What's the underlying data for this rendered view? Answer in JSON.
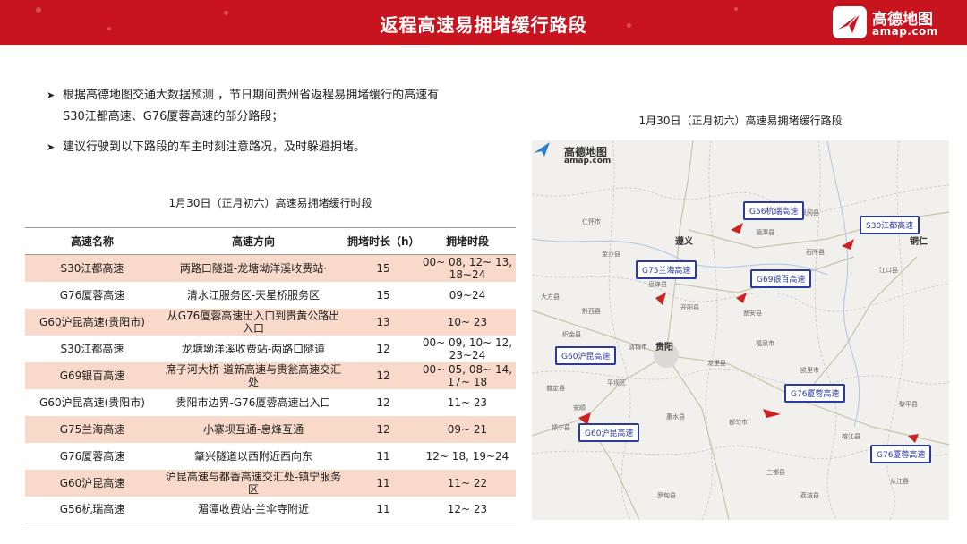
{
  "header": {
    "title": "返程高速易拥堵缓行路段",
    "brand_name": "高德地图",
    "brand_domain": "amap.com"
  },
  "bullets": [
    {
      "line1": "根据高德地图交通大数据预测 ，节日期间贵州省返程易拥堵缓行的高速有",
      "line2": "S30江都高速、G76厦蓉高速的部分路段；"
    },
    {
      "line1": "建议行驶到以下路段的车主时刻注意路况，及时躲避拥堵。",
      "line2": ""
    }
  ],
  "table": {
    "caption": "1月30日（正月初六）高速易拥堵缓行时段",
    "headers": [
      "高速名称",
      "高速方向",
      "拥堵时长（h）",
      "拥堵时段"
    ],
    "rows": [
      [
        "S30江都高速",
        "两路口隧道-龙塘坳洋溪收费站·",
        "15",
        "00~ 08, 12~ 13, 18~24"
      ],
      [
        "G76厦蓉高速",
        "清水江服务区-天星桥服务区",
        "15",
        "09~24"
      ],
      [
        "G60沪昆高速(贵阳市)",
        "从G76厦蓉高速出入口到贵黄公路出入口",
        "13",
        "10~ 23"
      ],
      [
        "S30江都高速",
        "龙塘坳洋溪收费站-两路口隧道",
        "12",
        "00~ 09, 10~ 12, 23~24"
      ],
      [
        "G69银百高速",
        "席子河大桥-道新高速与贵瓮高速交汇处",
        "12",
        "00~ 05, 08~ 14, 17~ 18"
      ],
      [
        "G60沪昆高速(贵阳市)",
        "贵阳市边界-G76厦蓉高速出入口",
        "12",
        "11~ 23"
      ],
      [
        "G75兰海高速",
        "小寨坝互通-息烽互通",
        "12",
        "09~ 21"
      ],
      [
        "G76厦蓉高速",
        "肇兴隧道以西附近西向东",
        "11",
        "12~ 18, 19~24"
      ],
      [
        "G60沪昆高速",
        "沪昆高速与都香高速交汇处-镇宁服务区",
        "11",
        "11~ 22"
      ],
      [
        "G56杭瑞高速",
        "湄潭收费站-兰伞寺附近",
        "11",
        "12~ 23"
      ]
    ]
  },
  "map": {
    "caption": "1月30日（正月初六）高速易拥堵缓行路段",
    "logo_name": "高德地图",
    "logo_domain": "amap.com",
    "city": "贵阳",
    "highway_labels": {
      "g56": "G56杭瑞高速",
      "s30": "S30江都高速",
      "g75": "G75兰海高速",
      "g69": "G69银百高速",
      "g60a": "G60沪昆高速",
      "g76a": "G76厦蓉高速",
      "g60b": "G60沪昆高速",
      "g76b": "G76厦蓉高速"
    },
    "places": {
      "p1": "金沙县",
      "p2": "仁怀市",
      "p3": "遵义",
      "p4": "湄潭县",
      "p5": "凤冈县",
      "p6": "石阡县",
      "p7": "铜仁",
      "p8": "江口县",
      "p9": "开阳县",
      "p10": "息烽县",
      "p11": "瓮安县",
      "p12": "黔西县",
      "p13": "清镇市",
      "p14": "龙里县",
      "p15": "福泉市",
      "p16": "凯里市",
      "p17": "平坝区",
      "p18": "安顺",
      "p19": "镇宁县",
      "p20": "惠水县",
      "p21": "都匀市",
      "p22": "三都县",
      "p23": "榕江县",
      "p24": "黎平县",
      "p25": "大方县",
      "p26": "织金县",
      "p27": "普定县",
      "p28": "罗甸县",
      "p29": "荔波县",
      "p30": "从江县"
    }
  },
  "colors": {
    "header_red": "#c8141f",
    "row_tint": "#f9d9c9",
    "label_blue": "#2b3a9f",
    "congestion_red": "#cc2222"
  }
}
